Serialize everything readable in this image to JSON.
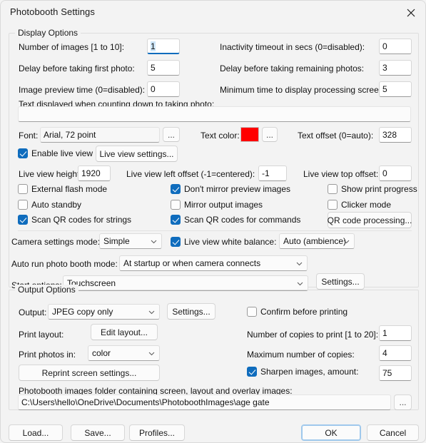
{
  "window": {
    "title": "Photobooth Settings",
    "close_icon": "close-icon"
  },
  "display_options": {
    "group_title": "Display Options",
    "number_of_images_label": "Number of images [1 to 10]:",
    "number_of_images_value": "1",
    "inactivity_timeout_label": "Inactivity timeout in secs (0=disabled):",
    "inactivity_timeout_value": "0",
    "delay_first_photo_label": "Delay before taking first photo:",
    "delay_first_photo_value": "5",
    "delay_remaining_photos_label": "Delay before taking remaining photos:",
    "delay_remaining_photos_value": "3",
    "image_preview_time_label": "Image preview time (0=disabled):",
    "image_preview_time_value": "0",
    "min_processing_time_label": "Minimum time to display processing screen:",
    "min_processing_time_value": "5",
    "countdown_text_label": "Text displayed when counting down to taking photo:",
    "countdown_text_value": "",
    "font_label": "Font:",
    "font_value": "Arial, 72 point",
    "font_browse_label": "...",
    "text_color_label": "Text color:",
    "text_color_value": "#FF0000",
    "text_color_browse_label": "...",
    "text_offset_label": "Text offset (0=auto):",
    "text_offset_value": "328",
    "enable_live_view_label": "Enable live view",
    "enable_live_view_checked": true,
    "live_view_settings_label": "Live view settings...",
    "live_view_height_label": "Live view height:",
    "live_view_height_value": "1920",
    "live_view_left_offset_label": "Live view left offset (-1=centered):",
    "live_view_left_offset_value": "-1",
    "live_view_top_offset_label": "Live view top offset:",
    "live_view_top_offset_value": "0",
    "external_flash_label": "External flash mode",
    "external_flash_checked": false,
    "dont_mirror_preview_label": "Don't mirror preview images",
    "dont_mirror_preview_checked": true,
    "show_print_progress_label": "Show print progress",
    "show_print_progress_checked": false,
    "auto_standby_label": "Auto standby",
    "auto_standby_checked": false,
    "mirror_output_label": "Mirror output images",
    "mirror_output_checked": false,
    "clicker_mode_label": "Clicker mode",
    "clicker_mode_checked": false,
    "scan_qr_strings_label": "Scan QR codes for strings",
    "scan_qr_strings_checked": true,
    "scan_qr_commands_label": "Scan QR codes for commands",
    "scan_qr_commands_checked": true,
    "qr_code_processing_label": "QR code processing...",
    "camera_settings_mode_label": "Camera settings mode:",
    "camera_settings_mode_value": "Simple",
    "live_view_wb_label": "Live view white balance:",
    "live_view_wb_checked": true,
    "live_view_wb_value": "Auto (ambience)",
    "auto_run_mode_label": "Auto run photo booth mode:",
    "auto_run_mode_value": "At startup or when camera connects",
    "start_options_label": "Start options:",
    "start_options_value": "Touchscreen",
    "start_options_settings_label": "Settings..."
  },
  "output_options": {
    "group_title": "Output Options",
    "output_label": "Output:",
    "output_value": "JPEG copy only",
    "output_settings_label": "Settings...",
    "confirm_before_printing_label": "Confirm before printing",
    "confirm_before_printing_checked": false,
    "print_layout_label": "Print layout:",
    "edit_layout_label": "Edit layout...",
    "copies_to_print_label": "Number of copies to print [1 to 20]:",
    "copies_to_print_value": "1",
    "print_photos_in_label": "Print photos in:",
    "print_photos_in_value": "color",
    "max_copies_label": "Maximum number of copies:",
    "max_copies_value": "4",
    "reprint_screen_settings_label": "Reprint screen settings...",
    "sharpen_images_label": "Sharpen images, amount:",
    "sharpen_images_checked": true,
    "sharpen_images_value": "75",
    "images_folder_label": "Photobooth images folder containing screen, layout and overlay images:",
    "images_folder_value": "C:\\Users\\hello\\OneDrive\\Documents\\PhotoboothImages\\age gate",
    "images_folder_browse_label": "..."
  },
  "footer": {
    "load_label": "Load...",
    "save_label": "Save...",
    "profiles_label": "Profiles...",
    "ok_label": "OK",
    "cancel_label": "Cancel"
  },
  "colors": {
    "accent": "#0f6cbd",
    "text_color_swatch": "#FF0000",
    "window_bg": "#f3f3f3"
  }
}
